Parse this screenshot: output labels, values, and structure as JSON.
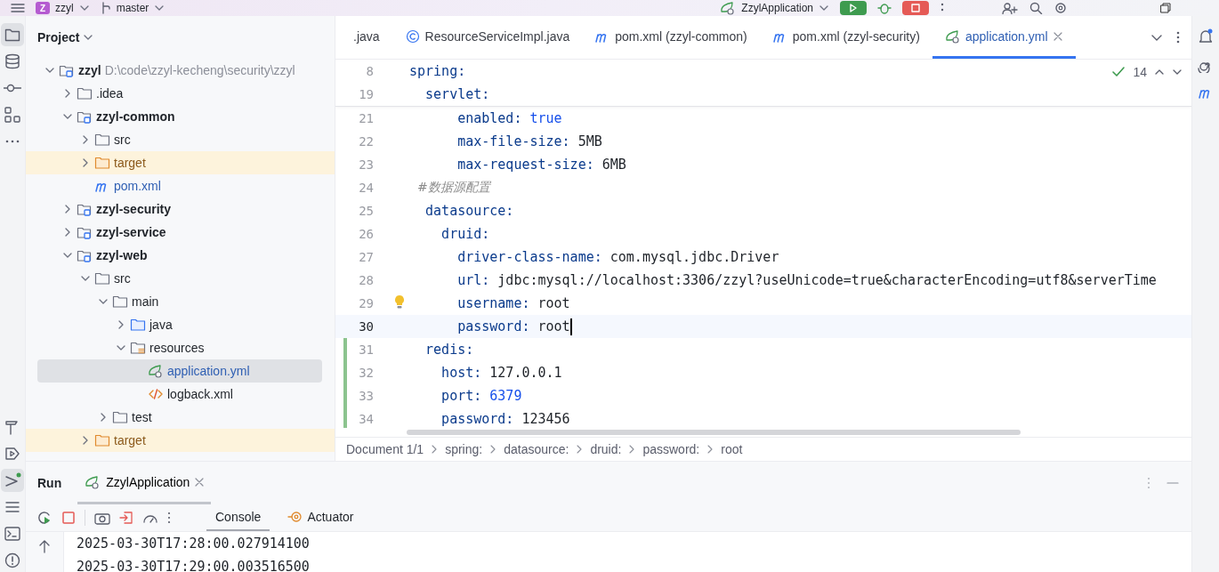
{
  "title_bar": {
    "project_badge": "Z",
    "project": "zzyl",
    "branch": "master",
    "run_config": "ZzylApplication"
  },
  "left_toolbar": [
    {
      "kind": "project",
      "selected": true
    },
    {
      "kind": "database",
      "selected": false
    },
    {
      "kind": "commit",
      "selected": false
    },
    {
      "kind": "structure",
      "selected": false
    },
    {
      "kind": "more",
      "selected": false
    },
    {
      "kind": "build",
      "selected": false
    },
    {
      "kind": "services",
      "selected": false
    },
    {
      "kind": "run",
      "selected": true
    },
    {
      "kind": "todo",
      "selected": false
    },
    {
      "kind": "terminal",
      "selected": false
    },
    {
      "kind": "problems",
      "selected": false
    }
  ],
  "project": {
    "title": "Project",
    "tree": [
      {
        "label": "zzyl",
        "path": "D:\\code\\zzyl-kecheng\\security\\zzyl",
        "kind": "module",
        "expanded": true,
        "selected": false,
        "children": [
          {
            "label": ".idea",
            "kind": "folder",
            "expanded": false,
            "selected": false
          },
          {
            "label": "zzyl-common",
            "kind": "module",
            "expanded": true,
            "selected": false,
            "children": [
              {
                "label": "src",
                "kind": "folder",
                "expanded": false,
                "selected": false
              },
              {
                "label": "target",
                "kind": "excluded",
                "expanded": false,
                "selected": false
              },
              {
                "label": "pom.xml",
                "kind": "maven",
                "selected": false
              }
            ]
          },
          {
            "label": "zzyl-security",
            "kind": "module",
            "expanded": false,
            "selected": false
          },
          {
            "label": "zzyl-service",
            "kind": "module",
            "expanded": false,
            "selected": false
          },
          {
            "label": "zzyl-web",
            "kind": "module",
            "expanded": true,
            "selected": false,
            "children": [
              {
                "label": "src",
                "kind": "folder",
                "expanded": true,
                "selected": false,
                "children": [
                  {
                    "label": "main",
                    "kind": "folder",
                    "expanded": true,
                    "selected": false,
                    "children": [
                      {
                        "label": "java",
                        "kind": "source",
                        "expanded": false,
                        "selected": false
                      },
                      {
                        "label": "resources",
                        "kind": "resources",
                        "expanded": true,
                        "selected": false,
                        "children": [
                          {
                            "label": "application.yml",
                            "kind": "yaml",
                            "selected": true
                          },
                          {
                            "label": "logback.xml",
                            "kind": "xml",
                            "selected": false
                          }
                        ]
                      }
                    ]
                  },
                  {
                    "label": "test",
                    "kind": "folder",
                    "expanded": false,
                    "selected": false
                  }
                ]
              },
              {
                "label": "target",
                "kind": "excluded",
                "expanded": false,
                "selected": false
              }
            ]
          }
        ]
      }
    ]
  },
  "editor": {
    "tabs": [
      {
        "label": ".java",
        "kind": "plain",
        "selected": false
      },
      {
        "label": "ResourceServiceImpl.java",
        "kind": "class",
        "selected": false
      },
      {
        "label": "pom.xml (zzyl-common)",
        "kind": "maven",
        "selected": false
      },
      {
        "label": "pom.xml (zzyl-security)",
        "kind": "maven",
        "selected": false
      },
      {
        "label": "application.yml",
        "kind": "yaml",
        "selected": true
      }
    ],
    "inspections": "14",
    "sticky_lines": [
      {
        "number": "8",
        "key": "spring:"
      },
      {
        "number": "19",
        "key": "  servlet:"
      }
    ],
    "lines": [
      {
        "number": "21",
        "key": "      enabled:",
        "value": "true",
        "literal": true
      },
      {
        "number": "22",
        "key": "      max-file-size:",
        "value": "5MB",
        "literal": false
      },
      {
        "number": "23",
        "key": "      max-request-size:",
        "value": "6MB",
        "literal": false
      },
      {
        "number": "24",
        "comment": "  #数据源配置"
      },
      {
        "number": "25",
        "key": "  datasource:"
      },
      {
        "number": "26",
        "key": "    druid:"
      },
      {
        "number": "27",
        "key": "      driver-class-name:",
        "value": "com.mysql.jdbc.Driver",
        "literal": false
      },
      {
        "number": "28",
        "key": "      url:",
        "value": "jdbc:mysql://localhost:3306/zzyl?useUnicode=true&characterEncoding=utf8&serverTime",
        "literal": false
      },
      {
        "number": "29",
        "key": "      username:",
        "value": "root",
        "literal": false,
        "hint": true
      },
      {
        "number": "30",
        "key": "      password:",
        "value": "root",
        "literal": false,
        "current": true
      },
      {
        "number": "31",
        "key": "  redis:",
        "changed": true
      },
      {
        "number": "32",
        "key": "    host:",
        "value": "127.0.0.1",
        "literal": false,
        "changed": true
      },
      {
        "number": "33",
        "key": "    port:",
        "value": "6379",
        "literal": true,
        "changed": true
      },
      {
        "number": "34",
        "key": "    password:",
        "value": "123456",
        "literal": false,
        "changed": true
      }
    ],
    "breadcrumbs": [
      "Document 1/1",
      "spring:",
      "datasource:",
      "druid:",
      "password:",
      "root"
    ]
  },
  "run": {
    "title": "Run",
    "tabs": [
      {
        "label": "ZzylApplication",
        "selected": true
      }
    ],
    "view_tabs": [
      {
        "label": "Console",
        "kind": "console",
        "selected": true
      },
      {
        "label": "Actuator",
        "kind": "actuator",
        "selected": false
      }
    ],
    "console": [
      "2025-03-30T17:28:00.027914100",
      "2025-03-30T17:29:00.003516500"
    ]
  }
}
